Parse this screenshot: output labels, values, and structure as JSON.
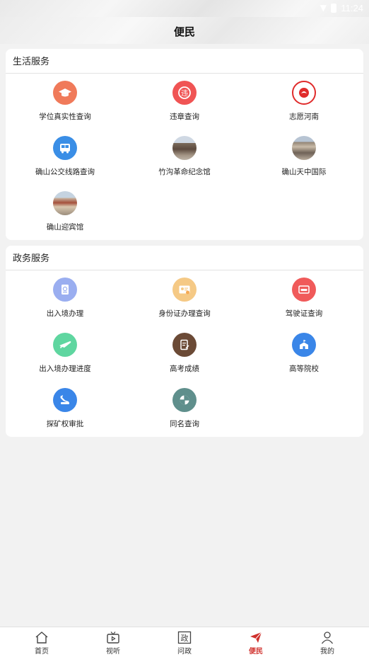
{
  "status_bar": {
    "time": "11:24"
  },
  "header": {
    "title": "便民"
  },
  "sections": [
    {
      "title": "生活服务",
      "items": [
        {
          "label": "学位真实性查询",
          "icon": "graduation-cap-icon",
          "color": "#f07a5a"
        },
        {
          "label": "违章查询",
          "icon": "traffic-violation-icon",
          "color": "#f05454"
        },
        {
          "label": "志愿河南",
          "icon": "volunteer-henan-logo-icon",
          "color": "#e02b2b"
        },
        {
          "label": "确山公交线路查询",
          "icon": "bus-icon",
          "color": "#3a8ee6"
        },
        {
          "label": "竹沟革命纪念馆",
          "icon": "memorial-photo-icon",
          "color": "#7a6a5a"
        },
        {
          "label": "确山天中国际",
          "icon": "building-photo-icon",
          "color": "#8f8272"
        },
        {
          "label": "确山迎宾馆",
          "icon": "hotel-photo-icon",
          "color": "#a5503b"
        }
      ]
    },
    {
      "title": "政务服务",
      "items": [
        {
          "label": "出入境办理",
          "icon": "passport-icon",
          "color": "#9aaef0"
        },
        {
          "label": "身份证办理查询",
          "icon": "id-card-icon",
          "color": "#f5c985"
        },
        {
          "label": "驾驶证查询",
          "icon": "driver-license-icon",
          "color": "#f05a5a"
        },
        {
          "label": "出入境办理进度",
          "icon": "airplane-icon",
          "color": "#5fd6a0"
        },
        {
          "label": "高考成绩",
          "icon": "score-report-icon",
          "color": "#6b4a36"
        },
        {
          "label": "高等院校",
          "icon": "university-icon",
          "color": "#3a86e8"
        },
        {
          "label": "探矿权审批",
          "icon": "mining-approval-icon",
          "color": "#3a86e8"
        },
        {
          "label": "同名查询",
          "icon": "same-name-icon",
          "color": "#5f8f8c"
        }
      ]
    }
  ],
  "tabbar": {
    "active_color": "#d0312d",
    "tabs": [
      {
        "label": "首页",
        "icon": "home-icon"
      },
      {
        "label": "视听",
        "icon": "tv-play-icon"
      },
      {
        "label": "问政",
        "icon": "government-icon"
      },
      {
        "label": "便民",
        "icon": "paper-plane-icon"
      },
      {
        "label": "我的",
        "icon": "user-icon"
      }
    ]
  }
}
